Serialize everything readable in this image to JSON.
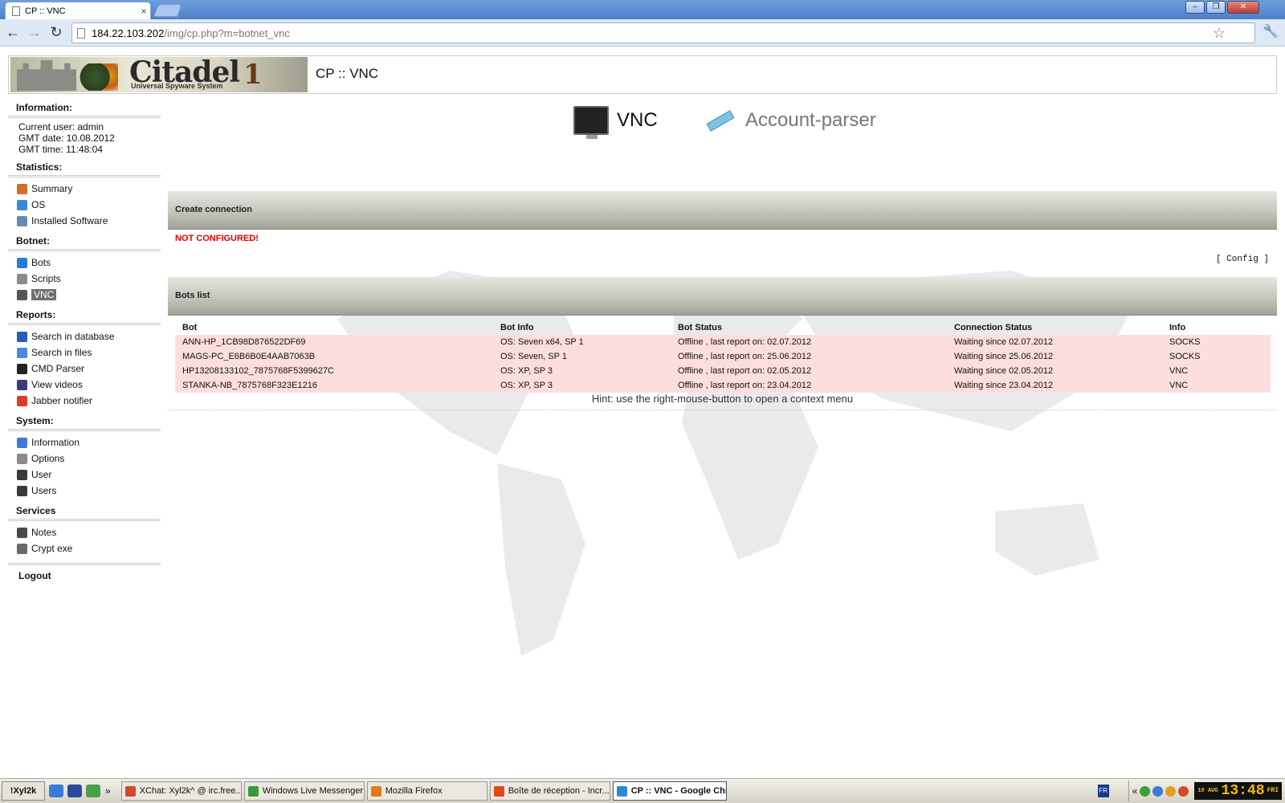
{
  "browser": {
    "tab_title": "CP :: VNC",
    "tab_close": "×",
    "url_host": "184.22.103.202",
    "url_path": "/img/cp.php?m=botnet_vnc",
    "nav_back": "←",
    "nav_forward": "→",
    "nav_reload": "↻",
    "star": "☆",
    "wrench": "🔧",
    "win_minimize": "–",
    "win_restore": "❐",
    "win_close": "✕"
  },
  "header": {
    "logo_text": "Citadel",
    "logo_badge": "1",
    "logo_sub": "Universal Spyware System",
    "title": "CP :: VNC"
  },
  "sidebar": {
    "information": {
      "title": "Information:",
      "current_user": "Current user: admin",
      "gmt_date": "GMT date: 10.08.2012",
      "gmt_time": "GMT time: 11:48:04"
    },
    "statistics": {
      "title": "Statistics:",
      "items": [
        {
          "label": "Summary",
          "icon": "house-icon",
          "color": "#d86a2a"
        },
        {
          "label": "OS",
          "icon": "windows-logo-icon",
          "color": "#3a8ad8"
        },
        {
          "label": "Installed Software",
          "icon": "software-icon",
          "color": "#6a8ab8"
        }
      ]
    },
    "botnet": {
      "title": "Botnet:",
      "items": [
        {
          "label": "Bots",
          "icon": "globe-icon",
          "color": "#2a7ad8"
        },
        {
          "label": "Scripts",
          "icon": "script-icon",
          "color": "#8a8a8a"
        },
        {
          "label": "VNC",
          "icon": "joystick-icon",
          "color": "#555555"
        }
      ]
    },
    "reports": {
      "title": "Reports:",
      "items": [
        {
          "label": "Search in database",
          "icon": "book-icon",
          "color": "#2a5ab8"
        },
        {
          "label": "Search in files",
          "icon": "folder-icon",
          "color": "#4a8ae0"
        },
        {
          "label": "CMD Parser",
          "icon": "terminal-icon",
          "color": "#222222"
        },
        {
          "label": "View videos",
          "icon": "video-icon",
          "color": "#3a3a7a"
        },
        {
          "label": "Jabber notifier",
          "icon": "jabber-icon",
          "color": "#e03a2a"
        }
      ]
    },
    "system": {
      "title": "System:",
      "items": [
        {
          "label": "Information",
          "icon": "info-icon",
          "color": "#3a7ad8"
        },
        {
          "label": "Options",
          "icon": "gear-icon",
          "color": "#8a8a8a"
        },
        {
          "label": "User",
          "icon": "user-icon",
          "color": "#3a3a3a"
        },
        {
          "label": "Users",
          "icon": "users-icon",
          "color": "#3a3a3a"
        }
      ]
    },
    "services": {
      "title": "Services",
      "items": [
        {
          "label": "Notes",
          "icon": "pen-icon",
          "color": "#4a4a4a"
        },
        {
          "label": "Crypt exe",
          "icon": "shield-icon",
          "color": "#6a6a6a"
        }
      ]
    },
    "logout": "Logout"
  },
  "main": {
    "modes": [
      {
        "label": "VNC",
        "icon": "monitor-icon",
        "active": true
      },
      {
        "label": "Account-parser",
        "icon": "syringe-icon",
        "active": false
      }
    ],
    "create_connection": {
      "title": "Create connection",
      "status": "NOT CONFIGURED!",
      "config_link": "[ Config ]"
    },
    "bots_list": {
      "title": "Bots list",
      "columns": [
        "Bot",
        "Bot Info",
        "Bot Status",
        "Connection Status",
        "Info"
      ],
      "rows": [
        [
          "ANN-HP_1CB98D876522DF69",
          "OS: Seven x64, SP 1",
          "Offline , last report on: 02.07.2012",
          "Waiting since 02.07.2012",
          "SOCKS"
        ],
        [
          "MAGS-PC_E6B6B0E4AAB7063B",
          "OS: Seven, SP 1",
          "Offline , last report on: 25.06.2012",
          "Waiting since 25.06.2012",
          "SOCKS"
        ],
        [
          "HP13208133102_7875768F5399627C",
          "OS: XP, SP 3",
          "Offline , last report on: 02.05.2012",
          "Waiting since 02.05.2012",
          "VNC"
        ],
        [
          "STANKA-NB_7875768F323E1216",
          "OS: XP, SP 3",
          "Offline , last report on: 23.04.2012",
          "Waiting since 23.04.2012",
          "VNC"
        ]
      ],
      "row_color": "#fddede",
      "hint": "Hint: use the right-mouse-button to open a context menu"
    }
  },
  "taskbar": {
    "start_label": "!Xyl2k",
    "more_label": "»",
    "tasks": [
      {
        "label": "XChat: Xyl2k^ @ irc.free...",
        "icon": "xchat-icon",
        "color": "#d04a2a",
        "active": false
      },
      {
        "label": "Windows Live Messenger",
        "icon": "messenger-icon",
        "color": "#3a9a3a",
        "active": false
      },
      {
        "label": "Mozilla Firefox",
        "icon": "firefox-icon",
        "color": "#e07a1a",
        "active": false
      },
      {
        "label": "Boîte de réception - Incr...",
        "icon": "mail-icon",
        "color": "#e0481a",
        "active": false
      },
      {
        "label": "CP :: VNC - Google Chr...",
        "icon": "chrome-icon",
        "color": "#2a8ad8",
        "active": true
      }
    ],
    "language": "FR",
    "tray_chevron": "«",
    "clock_date": "10 AUG",
    "clock_time": "13:48",
    "clock_day": "FRI"
  }
}
